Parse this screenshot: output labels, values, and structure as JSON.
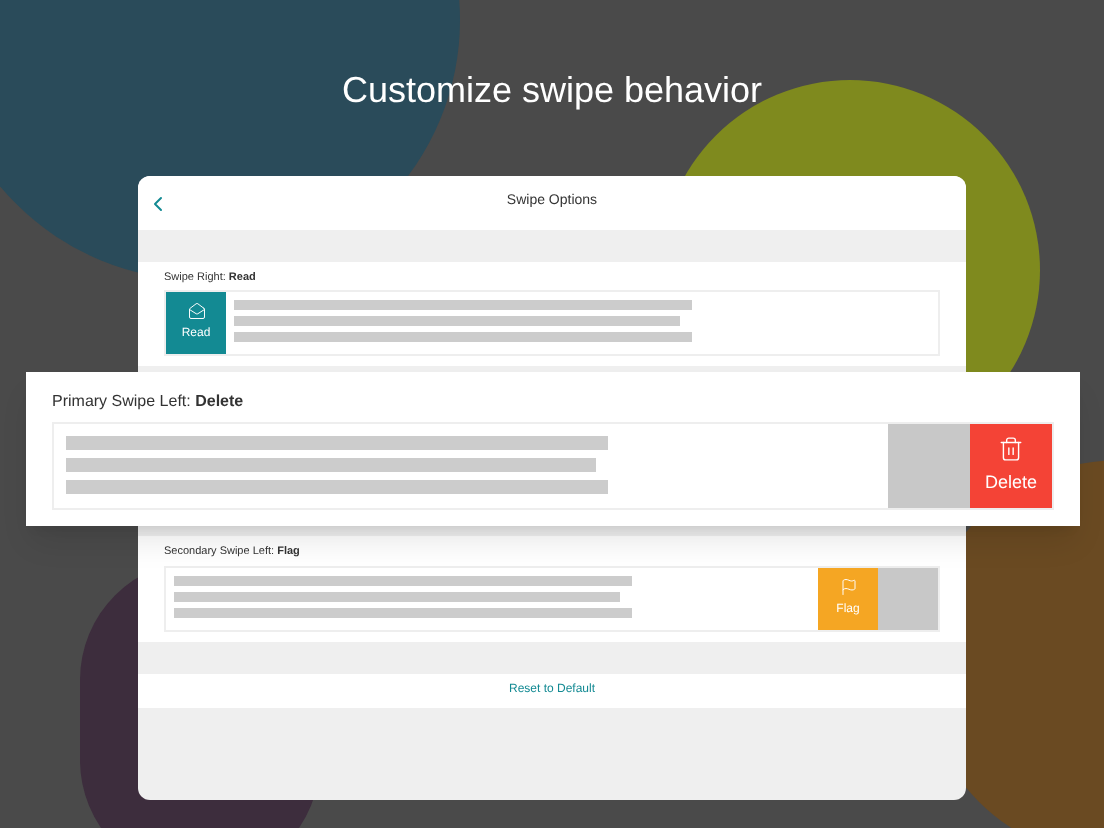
{
  "headline": "Customize swipe behavior",
  "window": {
    "title": "Swipe Options"
  },
  "sections": [
    {
      "label": "Swipe Right:",
      "action": "Read",
      "tile_label": "Read",
      "kind": "read",
      "color": "#138a93",
      "popped": false
    },
    {
      "label": "Primary Swipe Left:",
      "action": "Delete",
      "tile_label": "Delete",
      "kind": "delete",
      "color": "#f44336",
      "popped": true
    },
    {
      "label": "Secondary Swipe Left:",
      "action": "Flag",
      "tile_label": "Flag",
      "kind": "flag",
      "color": "#f5a623",
      "popped": false
    }
  ],
  "reset_button": "Reset to Default"
}
